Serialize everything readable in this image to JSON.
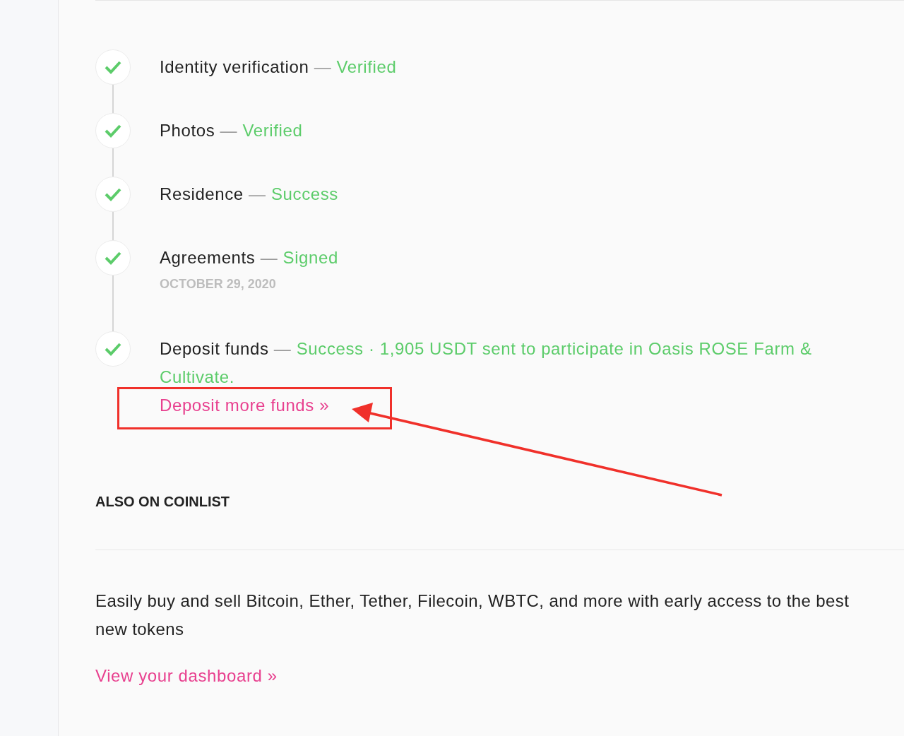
{
  "steps": [
    {
      "label": "Identity verification",
      "separator": "—",
      "status": "Verified",
      "completed": true
    },
    {
      "label": "Photos",
      "separator": "—",
      "status": "Verified",
      "completed": true
    },
    {
      "label": "Residence",
      "separator": "—",
      "status": "Success",
      "completed": true
    },
    {
      "label": "Agreements",
      "separator": "—",
      "status": "Signed",
      "date": "OCTOBER 29, 2020",
      "completed": true
    },
    {
      "label": "Deposit funds",
      "separator": "—",
      "status": "Success · 1,905 USDT sent to participate in Oasis ROSE Farm & Cultivate.",
      "link": "Deposit more funds »",
      "completed": true
    }
  ],
  "also": {
    "heading": "ALSO ON COINLIST",
    "text": "Easily buy and sell Bitcoin, Ether, Tether, Filecoin, WBTC, and more with early access to the best new tokens",
    "link": "View your dashboard »"
  }
}
